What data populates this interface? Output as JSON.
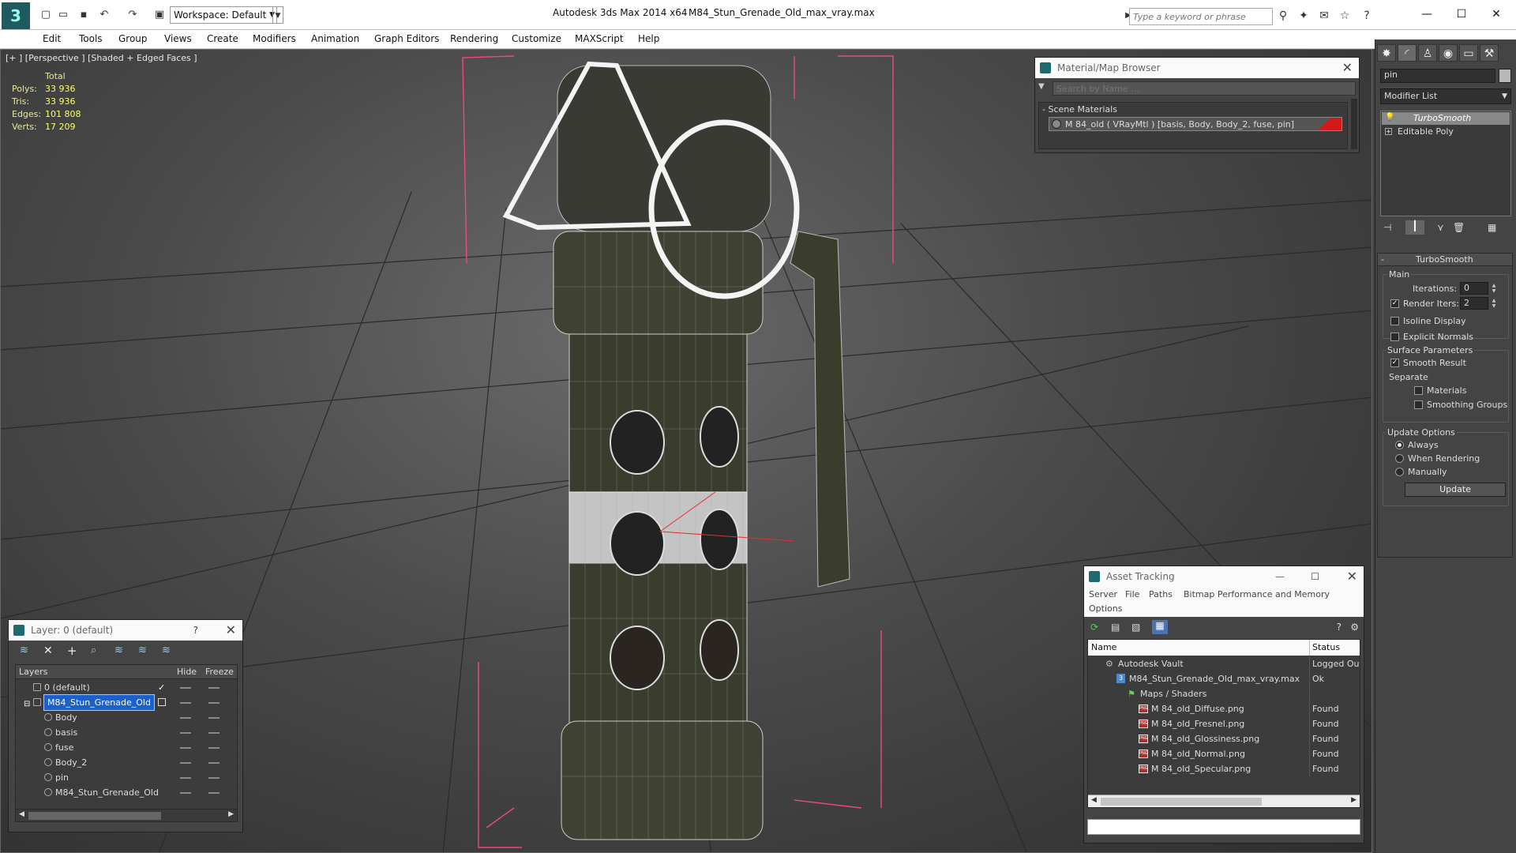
{
  "titlebar": {
    "workspace": "Workspace: Default",
    "app_title": "Autodesk 3ds Max  2014 x64",
    "document_title": "M84_Stun_Grenade_Old_max_vray.max",
    "search_placeholder": "Type a keyword or phrase"
  },
  "menu": [
    "Edit",
    "Tools",
    "Group",
    "Views",
    "Create",
    "Modifiers",
    "Animation",
    "Graph Editors",
    "Rendering",
    "Customize",
    "MAXScript",
    "Help"
  ],
  "viewport": {
    "label": "[+ ] [Perspective ] [Shaded + Edged Faces ]",
    "stats_header": "Total",
    "stats": [
      {
        "label": "Polys:",
        "value": "33 936"
      },
      {
        "label": "Tris:",
        "value": "33 936"
      },
      {
        "label": "Edges:",
        "value": "101 808"
      },
      {
        "label": "Verts:",
        "value": "17 209"
      }
    ]
  },
  "material_browser": {
    "title": "Material/Map Browser",
    "search_placeholder": "Search by Name ...",
    "section": "Scene Materials",
    "material": "M 84_old  ( VRayMtl ) [basis, Body, Body_2, fuse, pin]"
  },
  "command_panel": {
    "name_field": "pin",
    "modifier_list": "Modifier List",
    "stack": [
      "TurboSmooth",
      "Editable Poly"
    ],
    "rollout_title": "TurboSmooth",
    "main_label": "Main",
    "iterations_label": "Iterations:",
    "iterations_value": "0",
    "render_iters_label": "Render Iters:",
    "render_iters_value": "2",
    "isoline_display": "Isoline Display",
    "explicit_normals": "Explicit Normals",
    "surface_parameters": "Surface Parameters",
    "smooth_result": "Smooth Result",
    "separate_label": "Separate",
    "materials": "Materials",
    "smoothing_groups": "Smoothing Groups",
    "update_options": "Update Options",
    "always": "Always",
    "when_rendering": "When Rendering",
    "manually": "Manually",
    "update_button": "Update"
  },
  "layer_panel": {
    "title": "Layer: 0 (default)",
    "help": "?",
    "col_layers": "Layers",
    "col_hide": "Hide",
    "col_freeze": "Freeze",
    "rows": [
      {
        "name": "0 (default)",
        "indent": 0
      },
      {
        "name": "M84_Stun_Grenade_Old",
        "indent": 0
      },
      {
        "name": "Body",
        "indent": 1
      },
      {
        "name": "basis",
        "indent": 1
      },
      {
        "name": "fuse",
        "indent": 1
      },
      {
        "name": "Body_2",
        "indent": 1
      },
      {
        "name": "pin",
        "indent": 1
      },
      {
        "name": "M84_Stun_Grenade_Old",
        "indent": 1
      }
    ]
  },
  "asset_tracking": {
    "title": "Asset Tracking",
    "menu": [
      "Server",
      "File",
      "Paths",
      "Bitmap Performance and Memory",
      "Options"
    ],
    "col_name": "Name",
    "col_status": "Status",
    "rows": [
      {
        "name": "Autodesk Vault",
        "status": "Logged Out",
        "indent": 1
      },
      {
        "name": "M84_Stun_Grenade_Old_max_vray.max",
        "status": "Ok",
        "indent": 2
      },
      {
        "name": "Maps / Shaders",
        "status": "",
        "indent": 3
      },
      {
        "name": "M 84_old_Diffuse.png",
        "status": "Found",
        "indent": 4
      },
      {
        "name": "M 84_old_Fresnel.png",
        "status": "Found",
        "indent": 4
      },
      {
        "name": "M 84_old_Glossiness.png",
        "status": "Found",
        "indent": 4
      },
      {
        "name": "M 84_old_Normal.png",
        "status": "Found",
        "indent": 4
      },
      {
        "name": "M 84_old_Specular.png",
        "status": "Found",
        "indent": 4
      }
    ]
  },
  "colors": {
    "selection": "#1e5fc8",
    "stats": "#ffff66",
    "bbox": "#e84a8a",
    "grenade": "#3e4230"
  }
}
